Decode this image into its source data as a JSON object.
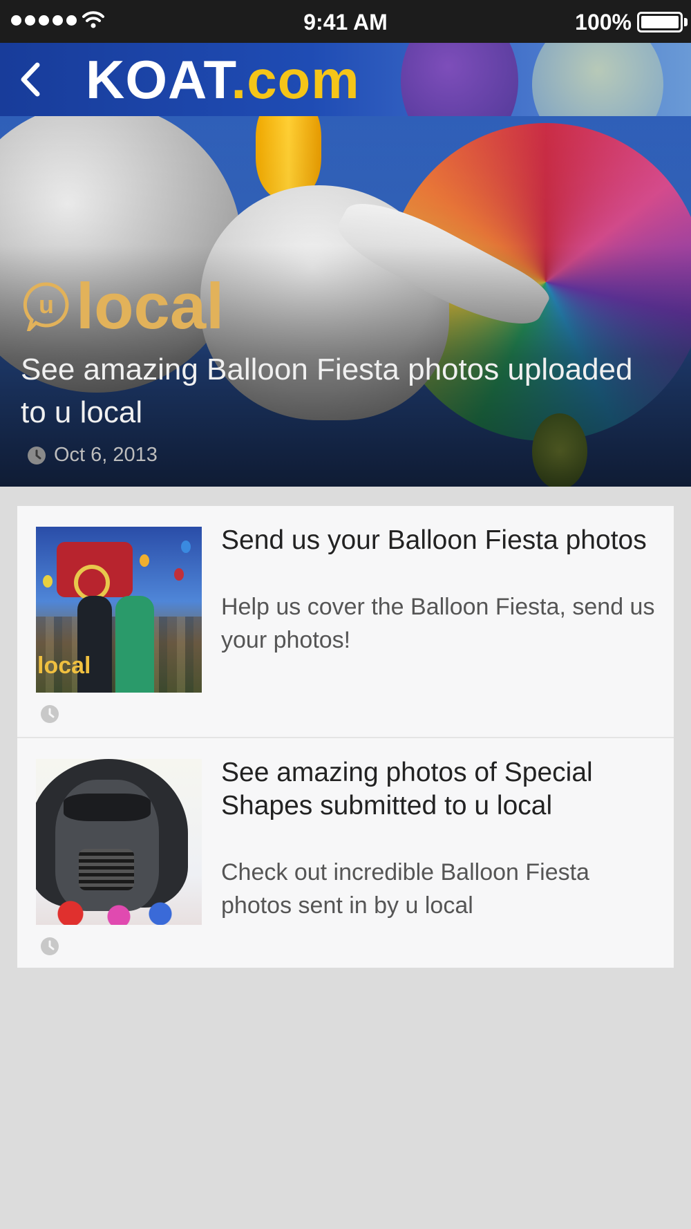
{
  "status_bar": {
    "time": "9:41 AM",
    "battery_percent": "100%",
    "signal_bars": 5,
    "icons": [
      "signal-dots-icon",
      "wifi-icon",
      "battery-icon"
    ]
  },
  "header": {
    "logo_main": "KOAT",
    "logo_suffix": ".com",
    "back_icon": "chevron-left-icon",
    "colors": {
      "bar": "#1f4cb4",
      "logo_main": "#ffffff",
      "logo_suffix": "#f5c518"
    }
  },
  "hero": {
    "brand_letter": "u",
    "brand_word": "local",
    "title": "See amazing Balloon Fiesta photos uploaded to u local",
    "date": "Oct 6, 2013",
    "brand_color": "#e2b25a"
  },
  "articles": [
    {
      "title": "Send us your Balloon Fiesta photos",
      "description": "Help us cover the Balloon Fiesta, send us your photos!",
      "thumbnail_overlay": "local",
      "timestamp": ""
    },
    {
      "title": "See amazing photos of Special Shapes submitted to u local",
      "description": "Check out incredible Balloon Fiesta photos sent in by u local",
      "timestamp": ""
    }
  ]
}
